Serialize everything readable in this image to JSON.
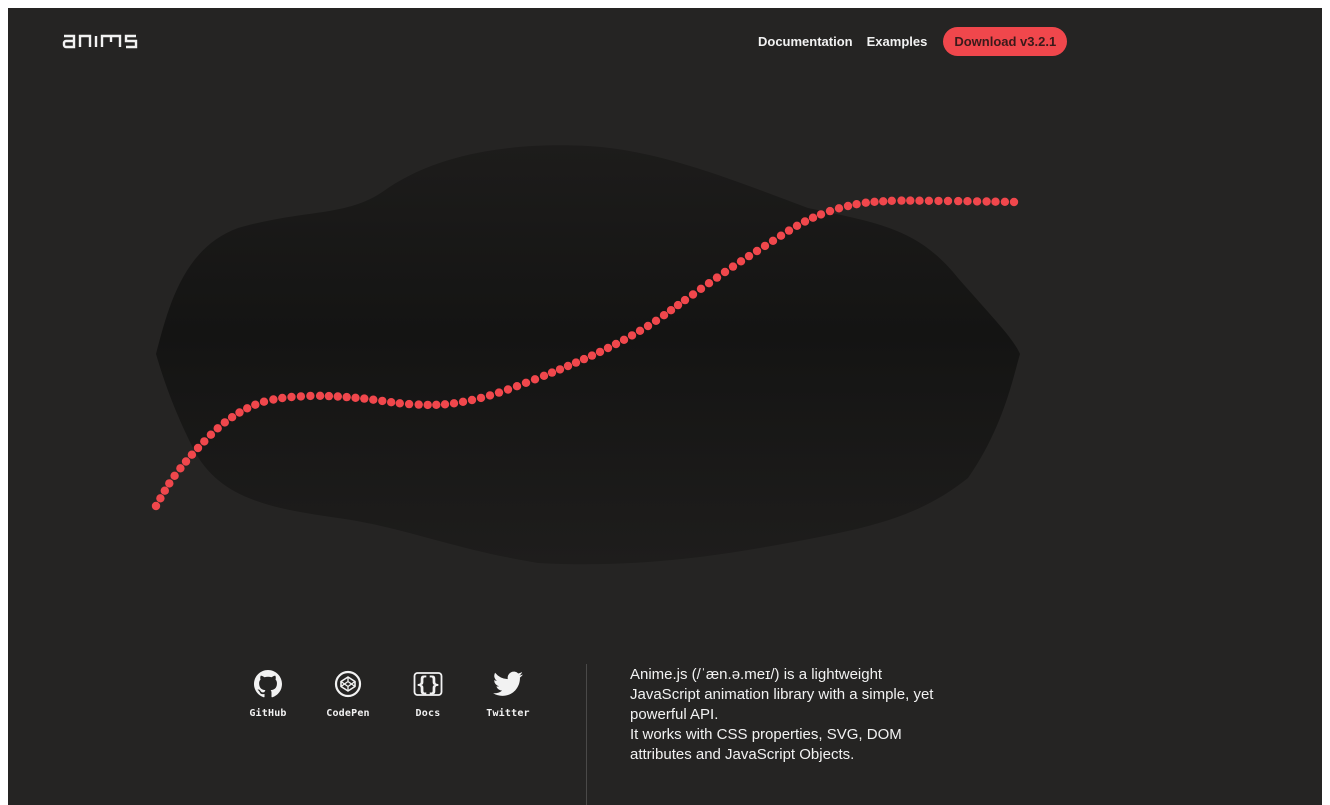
{
  "header": {
    "logo_text": "anime",
    "nav": {
      "documentation": "Documentation",
      "examples": "Examples",
      "download": "Download v3.2.1"
    }
  },
  "hero": {
    "blob_color": "#1c1b1a",
    "dot_color": "#f0474c"
  },
  "socials": [
    {
      "label": "GitHub",
      "icon": "github-icon"
    },
    {
      "label": "CodePen",
      "icon": "codepen-icon"
    },
    {
      "label": "Docs",
      "icon": "docs-braces-icon"
    },
    {
      "label": "Twitter",
      "icon": "twitter-bird-icon"
    }
  ],
  "description": {
    "line1": "Anime.js (/ˈæn.ə.meɪ/) is a lightweight JavaScript animation library with a simple, yet powerful API.",
    "line2": "It works with CSS properties, SVG, DOM attributes and JavaScript Objects."
  },
  "colors": {
    "background": "#252423",
    "accent": "#f0474c",
    "text": "#f2f2f2"
  }
}
